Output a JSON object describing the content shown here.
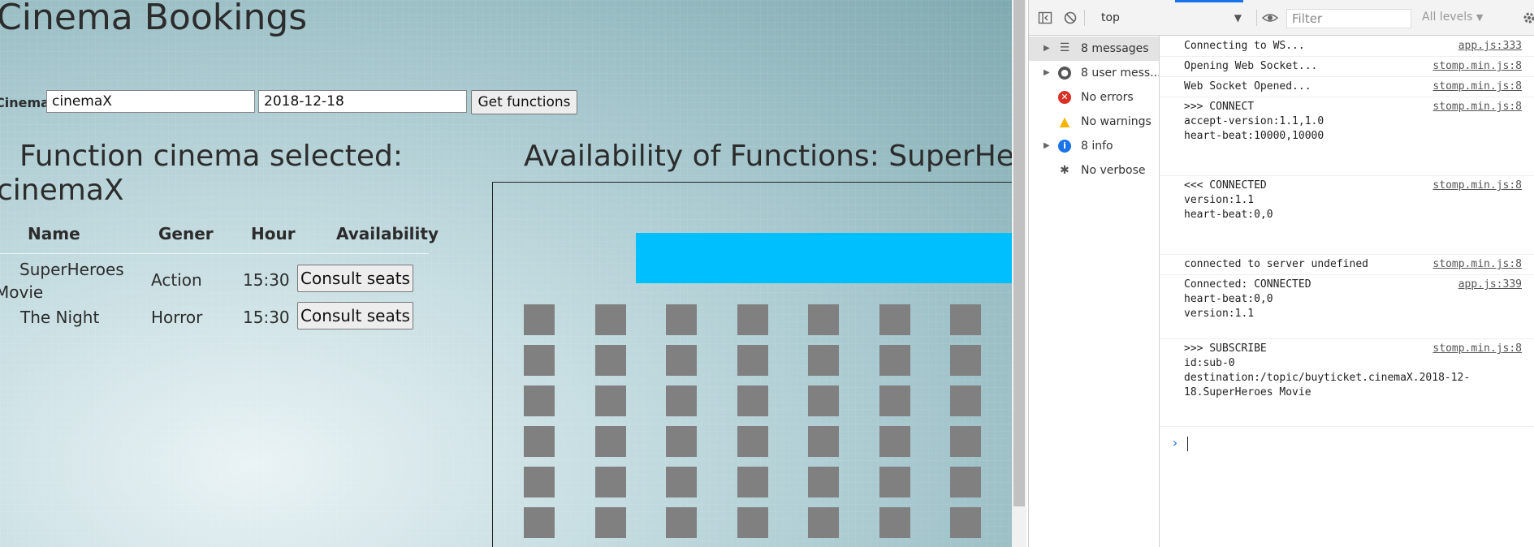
{
  "page": {
    "title": "Cinema Bookings",
    "search": {
      "cinema_label": "Cinema:",
      "cinema_value": "cinemaX",
      "date_value": "2018-12-18",
      "button_label": "Get functions"
    },
    "selected_heading": "Function cinema selected: cinemaX",
    "table": {
      "headers": [
        "Name",
        "Gener",
        "Hour",
        "Availability"
      ],
      "rows": [
        {
          "name": "SuperHeroes Movie",
          "gener": "Action",
          "hour": "15:30",
          "action": "Consult seats"
        },
        {
          "name": "The Night",
          "gener": "Horror",
          "hour": "15:30",
          "action": "Consult seats"
        }
      ]
    },
    "availability_heading": "Availability of Functions: SuperHeroes Movie",
    "seat_grid": {
      "rows": 6,
      "columns": 7,
      "seat_color": "#808080",
      "screen_color": "#00bfff"
    }
  },
  "devtools": {
    "toolbar": {
      "context": "top",
      "filter_placeholder": "Filter",
      "levels": "All levels"
    },
    "sidebar": [
      {
        "label": "8 messages",
        "icon": "list-icon",
        "expandable": true,
        "selected": true
      },
      {
        "label": "8 user mess...",
        "icon": "user-icon",
        "expandable": true,
        "selected": false
      },
      {
        "label": "No errors",
        "icon": "error-icon",
        "expandable": false,
        "selected": false,
        "color": "#d93025"
      },
      {
        "label": "No warnings",
        "icon": "warning-icon",
        "expandable": false,
        "selected": false,
        "color": "#f4b400"
      },
      {
        "label": "8 info",
        "icon": "info-icon",
        "expandable": true,
        "selected": false,
        "color": "#1a73e8"
      },
      {
        "label": "No verbose",
        "icon": "bug-icon",
        "expandable": false,
        "selected": false
      }
    ],
    "messages": [
      {
        "text": "Connecting to WS...",
        "source": "app.js:333"
      },
      {
        "text": "Opening Web Socket...",
        "source": "stomp.min.js:8"
      },
      {
        "text": "Web Socket Opened...",
        "source": "stomp.min.js:8"
      },
      {
        "text": ">>> CONNECT\naccept-version:1.1,1.0\nheart-beat:10000,10000",
        "source": "stomp.min.js:8"
      },
      {
        "text": "<<< CONNECTED\nversion:1.1\nheart-beat:0,0",
        "source": "stomp.min.js:8"
      },
      {
        "text": "connected to server undefined",
        "source": "stomp.min.js:8"
      },
      {
        "text": "Connected: CONNECTED\nheart-beat:0,0\nversion:1.1",
        "source": "app.js:339"
      },
      {
        "text": ">>> SUBSCRIBE\nid:sub-0\ndestination:/topic/buyticket.cinemaX.2018-12-\n18.SuperHeroes Movie",
        "source": "stomp.min.js:8"
      }
    ]
  }
}
